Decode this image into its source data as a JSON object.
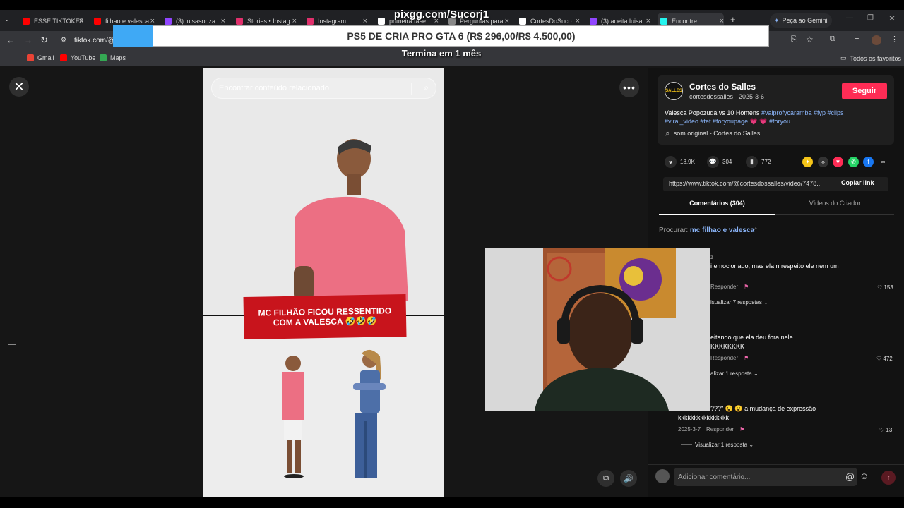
{
  "overlay": {
    "top_text": "pixgg.com/Sucorj1",
    "banner_text": "PS5 DE CRIA PRO GTA 6 (R$ 296,00/R$ 4.500,00)",
    "subtitle": "Termina em 1 mês"
  },
  "browser": {
    "tabs": [
      {
        "label": "ESSE TIKTOKER",
        "color": "#ff0000"
      },
      {
        "label": "filhao e valesca",
        "color": "#ff0000"
      },
      {
        "label": "(3) luisasonza",
        "color": "#9146ff"
      },
      {
        "label": "Stories • Instag",
        "color": "#e1306c"
      },
      {
        "label": "Instagram",
        "color": "#e1306c"
      },
      {
        "label": "primeira fase",
        "color": "#ffffff"
      },
      {
        "label": "Perguntas para",
        "color": "#888888"
      },
      {
        "label": "CortesDoSuco",
        "color": "#ffffff"
      },
      {
        "label": "(3) aceita luisa",
        "color": "#9146ff"
      },
      {
        "label": "Encontre",
        "color": "#25f4ee"
      }
    ],
    "new_tab": "+",
    "gemini_label": "Peça ao Gemini",
    "url": "tiktok.com/@",
    "bookmarks": [
      {
        "label": "Gmail",
        "color": "#ea4335"
      },
      {
        "label": "YouTube",
        "color": "#ff0000"
      },
      {
        "label": "Maps",
        "color": "#34a853"
      }
    ],
    "all_bookmarks": "Todos os favoritos"
  },
  "video": {
    "search_placeholder": "Encontrar conteúdo relacionado",
    "caption_line1": "MC FILHÃO FICOU RESSENTIDO",
    "caption_line2": "COM A VALESCA 🤣🤣🤣"
  },
  "post": {
    "creator_name": "Cortes do Salles",
    "creator_meta": "cortesdossalles · 2025-3-6",
    "avatar_text": "SALLES",
    "follow_label": "Seguir",
    "description": "Valesca Popozuda vs 10 Homens",
    "tags_line1": "#vaiprofycaramba #fyp #clips",
    "tags_line2": "#viral_video #tet #foryoupage",
    "tags_line2_end": "#foryou",
    "music": "som original - Cortes do Salles",
    "likes": "18.9K",
    "comments": "304",
    "saves": "772",
    "link": "https://www.tiktok.com/@cortesdossalles/video/7478...",
    "copy_link": "Copiar link"
  },
  "tabs": {
    "comments": "Comentários (304)",
    "videos": "Vídeos do Criador"
  },
  "search": {
    "label": "Procurar:",
    "query": "mc filhao e valesca"
  },
  "comments": [
    {
      "user": "z_",
      "text": "i emocionado, mas ela n respeito ele nem um",
      "reply": "Responder",
      "likes": "153",
      "replies": "isualizar 7 respostas"
    },
    {
      "text1": "eitando que ela deu fora nele",
      "text2": "KKKKKKKK",
      "reply": "Responder",
      "likes": "472",
      "replies": "alizar 1 resposta"
    },
    {
      "text1": "???\" 😮 😮  a mudança de expressão",
      "text2": "kkkkkkkkkkkkkkkk",
      "date": "2025-3-7",
      "reply": "Responder",
      "likes": "13",
      "replies": "Visualizar 1 resposta"
    }
  ],
  "comment_input_placeholder": "Adicionar comentário..."
}
